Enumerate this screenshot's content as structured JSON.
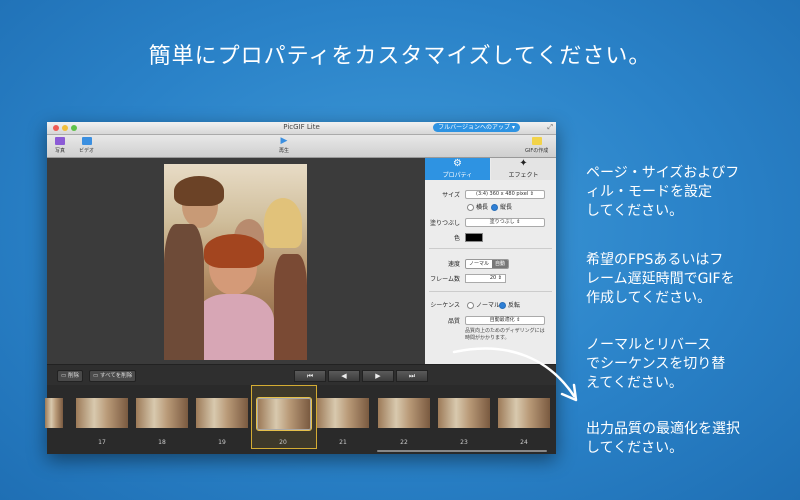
{
  "headline": "簡単にプロパティをカスタマイズしてください。",
  "window": {
    "title": "PicGIF Lite",
    "upgrade_label": "フルバージョンへのアップ",
    "toolbar": {
      "photo": "写真",
      "video": "ビデオ",
      "play": "再生",
      "create_gif": "GIFの作成"
    }
  },
  "panel": {
    "tabs": {
      "properties": "プロパティ",
      "effects": "エフェクト"
    },
    "size_label": "サイズ",
    "size_value": "(3:4) 360 x 480 pixel",
    "orientation": [
      "横長",
      "縦長"
    ],
    "fill_label": "塗りつぶし",
    "fill_value": "塗りつぶし",
    "color_label": "色",
    "speed_label": "速度",
    "speed_modes": [
      "ノーマル",
      "自動"
    ],
    "frames_label": "フレーム数",
    "frames_value": "20",
    "sequence_label": "シーケンス",
    "sequence_options": [
      "ノーマル",
      "反転"
    ],
    "quality_label": "品質",
    "quality_value": "自動最適化",
    "quality_note": "品質向上のためのディザリングには時間がかかります。"
  },
  "controls": {
    "delete": "削除",
    "delete_all": "すべてを削除"
  },
  "frames": [
    "17",
    "18",
    "19",
    "20",
    "21",
    "22",
    "23",
    "24"
  ],
  "selected_frame": "20",
  "captions": [
    "ページ・サイズおよびフ\nィル・モードを設定\nしてください。",
    "希望のFPSあるいはフ\nレーム遅延時間でGIFを\n作成してください。",
    "ノーマルとリバース\nでシーケンスを切り替\nえてください。",
    "出力品質の最適化を選択\nしてください。"
  ],
  "colors": {
    "accent": "#2e93e2",
    "selection": "#d4ac33",
    "background": "#2a82c8"
  }
}
